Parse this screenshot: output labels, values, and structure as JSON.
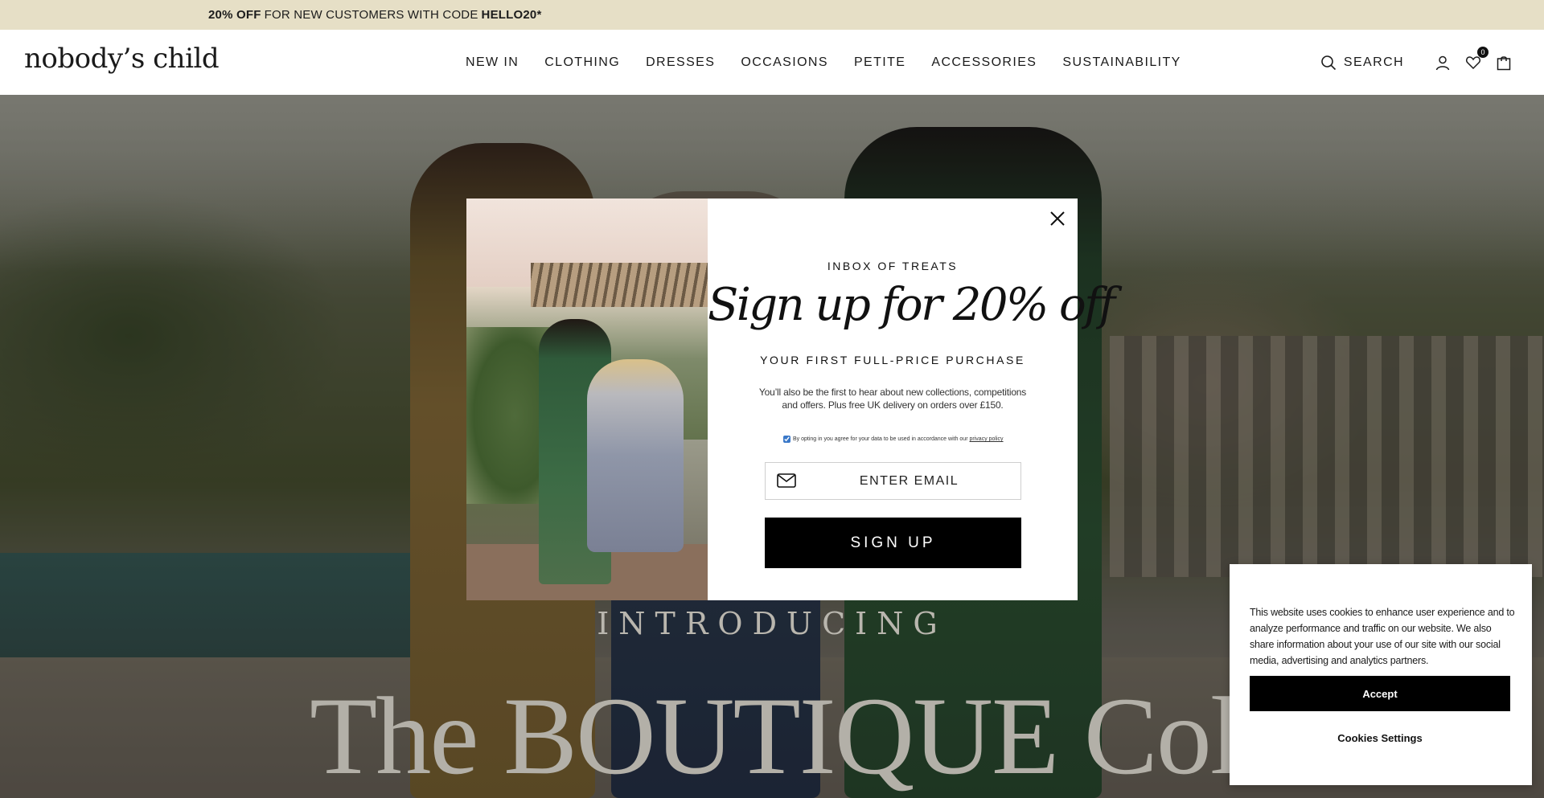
{
  "promo": {
    "discount": "20% OFF",
    "text": "FOR NEW CUSTOMERS WITH CODE",
    "code": "HELLO20*"
  },
  "header": {
    "logo": "nobody’s child",
    "nav": [
      "NEW IN",
      "CLOTHING",
      "DRESSES",
      "OCCASIONS",
      "PETITE",
      "ACCESSORIES",
      "SUSTAINABILITY"
    ],
    "search_label": "SEARCH",
    "wishlist_count": "0",
    "icons": [
      "search-icon",
      "account-icon",
      "wishlist-heart-icon",
      "bag-icon"
    ]
  },
  "hero": {
    "kicker": "INTRODUCING",
    "title": "The BOUTIQUE Collection"
  },
  "modal": {
    "eyebrow": "INBOX OF TREATS",
    "headline": "Sign up for 20% off",
    "subhead": "YOUR FIRST FULL-PRICE PURCHASE",
    "description": "You’ll also be the first to hear about new collections, competitions and offers. Plus free UK delivery on orders over £150.",
    "consent_text": "By opting in you agree for your data to be used in accordance with our",
    "consent_link": "privacy policy",
    "consent_checked": true,
    "email_placeholder": "ENTER EMAIL",
    "button": "SIGN UP"
  },
  "cookie": {
    "text": "This website uses cookies to enhance user experience and to analyze performance and traffic on our website. We also share information about your use of our site with our social media, advertising and analytics partners.",
    "accept": "Accept",
    "settings": "Cookies Settings"
  },
  "colors": {
    "promo_bg": "#e6dfc6",
    "button_bg": "#000000",
    "header_bg": "#ffffff"
  }
}
